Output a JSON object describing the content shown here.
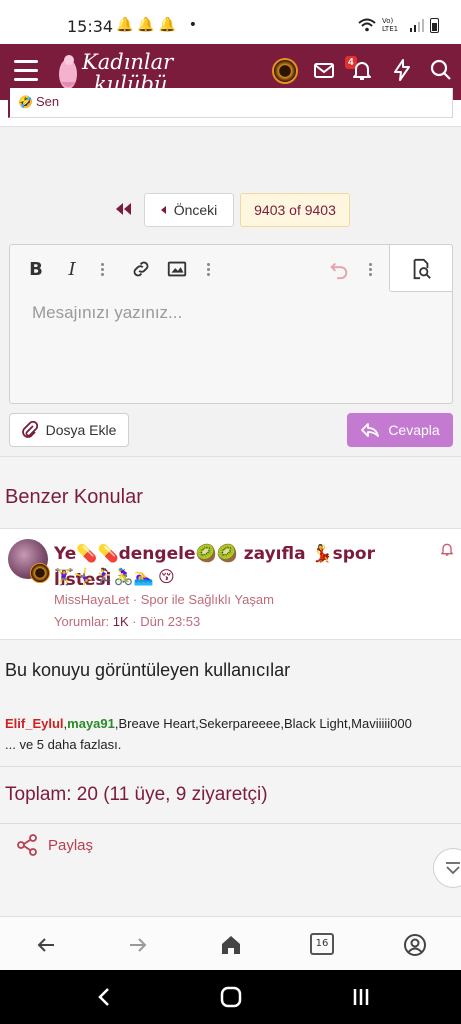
{
  "status_bar": {
    "time": "15:34",
    "notif_icons": "🔔🔔🔔 •",
    "network_label": "Vo) LTE1"
  },
  "app_bar": {
    "logo_line1": "Kadınlar",
    "logo_line2": "kulübü",
    "notifications_count": "4"
  },
  "previous_post": {
    "snippet": "Sen"
  },
  "pagination": {
    "prev_label": "Önceki",
    "current_label": "9403 of 9403"
  },
  "editor": {
    "placeholder": "Mesajınızı yazınız...",
    "bold": "B",
    "italic": "I"
  },
  "actions": {
    "attach_label": "Dosya Ekle",
    "reply_label": "Cevapla"
  },
  "similar": {
    "heading": "Benzer Konular",
    "item": {
      "title": "Ye💊💊dengele🥝🥝 zayıfla 💃spor listesi",
      "title_line2": "🏋️‍♀️🤸‍♀️🏃‍♀️🚴‍♀️🏊‍♀️ 😚",
      "author": "MissHayaLet",
      "forum": "Spor ile Sağlıklı Yaşam",
      "replies_label": "Yorumlar:",
      "replies_value": "1K",
      "date": "Dün 23:53"
    }
  },
  "viewers": {
    "heading": "Bu konuyu görüntüleyen kullanıcılar",
    "user1": "Elif_Eylul",
    "user2": "maya91",
    "others": "Breave Heart,Sekerpareeee,Black Light,Maviiiii000",
    "more": "... ve 5 daha fazlası."
  },
  "total": "Toplam: 20 (11 üye, 9 ziyaretçi)",
  "share_label": "Paylaş",
  "browser_nav": {
    "tab_count": "16"
  },
  "colors": {
    "brand": "#7c1c3c",
    "reply": "#c37ad0",
    "accent_text": "#c06a7a"
  }
}
